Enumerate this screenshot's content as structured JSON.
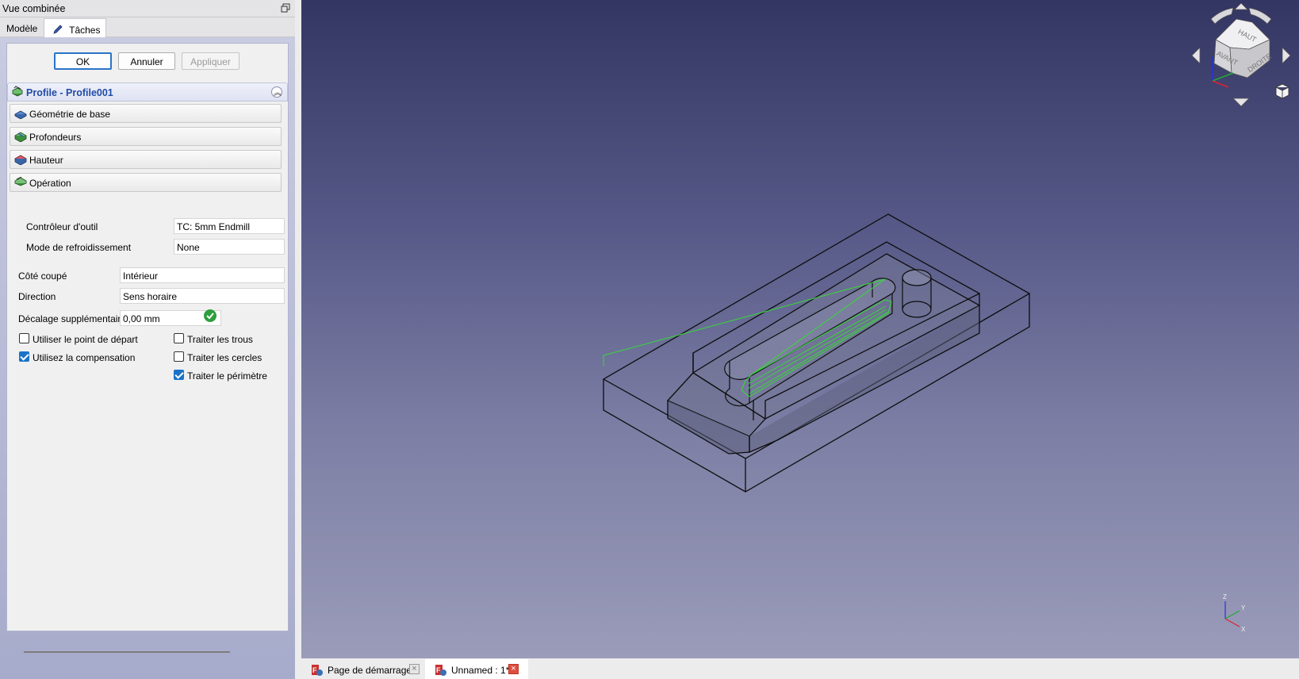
{
  "combo": {
    "title": "Vue combinée",
    "tabs": {
      "model": "Modèle",
      "tasks": "Tâches"
    }
  },
  "buttons": {
    "ok": "OK",
    "cancel": "Annuler",
    "apply": "Appliquer"
  },
  "section": {
    "title": "Profile - Profile001",
    "groups": [
      {
        "label": "Géométrie de base",
        "icon": "base-geometry-icon"
      },
      {
        "label": "Profondeurs",
        "icon": "depths-icon"
      },
      {
        "label": "Hauteur",
        "icon": "height-icon"
      },
      {
        "label": "Opération",
        "icon": "operation-icon"
      }
    ]
  },
  "form": {
    "tool_controller_label": "Contrôleur d'outil",
    "tool_controller_value": "TC: 5mm Endmill",
    "coolant_label": "Mode de refroidissement",
    "coolant_value": "None",
    "cut_side_label": "Côté coupé",
    "cut_side_value": "Intérieur",
    "direction_label": "Direction",
    "direction_value": "Sens horaire",
    "extra_offset_label": "Décalage supplémentaire",
    "extra_offset_value": "0,00 mm",
    "checkboxes": {
      "use_start_point": {
        "label": "Utiliser le point de départ",
        "checked": false
      },
      "use_compensation": {
        "label": "Utilisez la compensation",
        "checked": true
      },
      "process_holes": {
        "label": "Traiter les trous",
        "checked": false
      },
      "process_circles": {
        "label": "Traiter les cercles",
        "checked": false
      },
      "process_perimeter": {
        "label": "Traiter le périmètre",
        "checked": true
      }
    }
  },
  "navcube": {
    "top": "HAUT",
    "front": "AVANT",
    "right": "DROITE"
  },
  "axes": {
    "x": "X",
    "y": "Y",
    "z": "Z"
  },
  "doc_tabs": {
    "start_page": "Page de démarrage",
    "unnamed": "Unnamed : 1*"
  },
  "colors": {
    "accent": "#1a73c9",
    "section_title": "#1f4ba8",
    "toolpath": "#33dd33",
    "bg_top": "#333562",
    "bg_bottom": "#9b9cba"
  }
}
